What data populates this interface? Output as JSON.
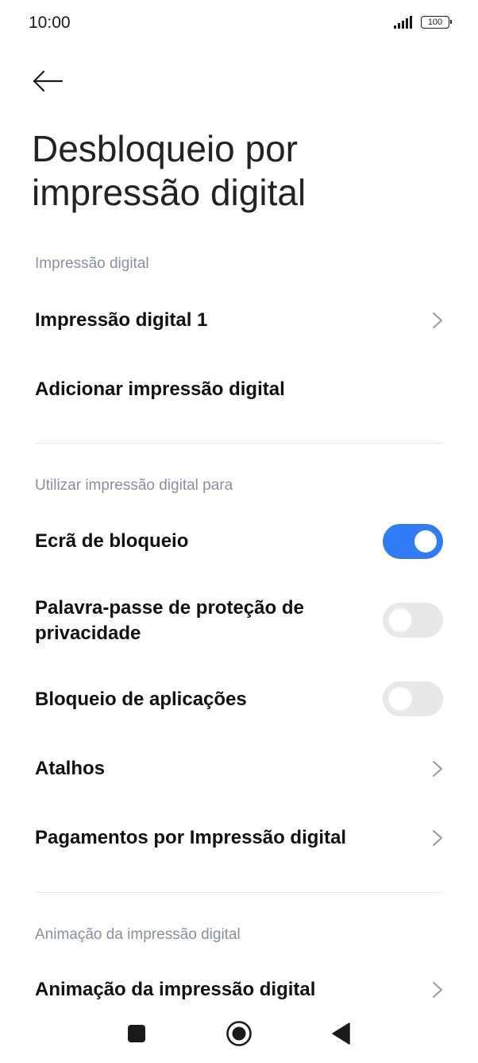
{
  "status_bar": {
    "time": "10:00",
    "battery": "100",
    "icons": [
      "signal-icon",
      "battery-icon"
    ]
  },
  "header": {
    "back_icon": "arrow-left-icon",
    "title": "Desbloqueio por impressão digital"
  },
  "sections": {
    "fingerprint": {
      "header": "Impressão digital",
      "items": [
        {
          "label": "Impressão digital 1"
        },
        {
          "label": "Adicionar impressão digital"
        }
      ]
    },
    "use_for": {
      "header": "Utilizar impressão digital para",
      "items": [
        {
          "label": "Ecrã de bloqueio",
          "toggle": true
        },
        {
          "label": "Palavra-passe de proteção de privacidade",
          "toggle": false
        },
        {
          "label": "Bloqueio de aplicações",
          "toggle": false
        },
        {
          "label": "Atalhos"
        },
        {
          "label": "Pagamentos por Impressão digital"
        }
      ]
    },
    "animation": {
      "header": "Animação da impressão digital",
      "items": [
        {
          "label": "Animação da impressão digital"
        }
      ]
    }
  },
  "colors": {
    "accent": "#2f7cf6",
    "toggle_off": "#e8e8e8",
    "section_header": "#8a8fa0"
  },
  "nav_bar": {
    "icons": [
      "recents-square-icon",
      "home-circle-icon",
      "back-triangle-icon"
    ]
  }
}
